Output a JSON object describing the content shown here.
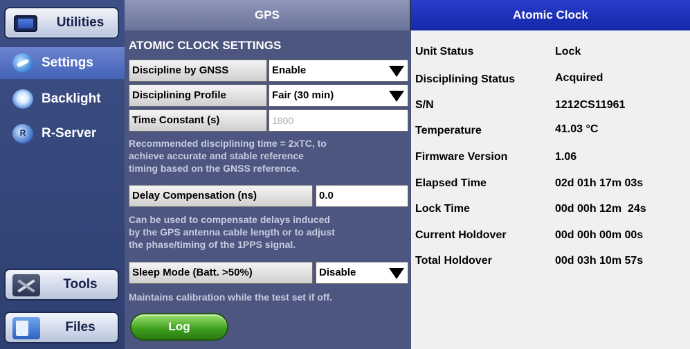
{
  "sidebar": {
    "utilities_label": "Utilities",
    "items": [
      {
        "label": "Settings",
        "icon": "settings-icon"
      },
      {
        "label": "Backlight",
        "icon": "backlight-icon"
      },
      {
        "label": "R-Server",
        "icon": "r-server-icon"
      }
    ],
    "rserver_icon_glyph": "R",
    "tools_label": "Tools",
    "files_label": "Files"
  },
  "gps": {
    "header": "GPS",
    "section_title": "ATOMIC CLOCK SETTINGS",
    "discipline_gnss": {
      "label": "Discipline by GNSS",
      "value": "Enable"
    },
    "discipline_profile": {
      "label": "Disciplining Profile",
      "value": "Fair (30 min)"
    },
    "time_constant": {
      "label": "Time Constant (s)",
      "value": "1800"
    },
    "note_recommended": [
      "Recommended disciplining time = 2xTC, to",
      "achieve accurate and stable reference",
      "timing based on the GNSS reference."
    ],
    "delay_compensation": {
      "label": "Delay Compensation (ns)",
      "value": "0.0"
    },
    "note_delay": [
      "Can be used to compensate delays induced",
      "by the GPS antenna cable length or to adjust",
      "the phase/timing of the 1PPS signal."
    ],
    "sleep_mode": {
      "label": "Sleep Mode (Batt. >50%)",
      "value": "Disable"
    },
    "note_sleep": "Maintains calibration while the test set if off.",
    "log_label": "Log"
  },
  "atomic_clock": {
    "header": "Atomic Clock",
    "rows": [
      {
        "label": "Unit Status",
        "value": "Lock"
      },
      {
        "label": "Disciplining Status",
        "value": "Acquired"
      },
      {
        "label": "S/N",
        "value": "1212CS11961"
      },
      {
        "label": "Temperature",
        "value": "41.03 °C"
      },
      {
        "label": "Firmware Version",
        "value": "1.06"
      },
      {
        "label": "Elapsed Time",
        "value": "02d 01h 17m 03s"
      },
      {
        "label": "Lock Time",
        "value": "00d 00h 12m  24s"
      },
      {
        "label": "Current Holdover",
        "value": "00d 00h 00m 00s"
      },
      {
        "label": "Total Holdover",
        "value": "00d 03h 10m 57s"
      }
    ]
  }
}
